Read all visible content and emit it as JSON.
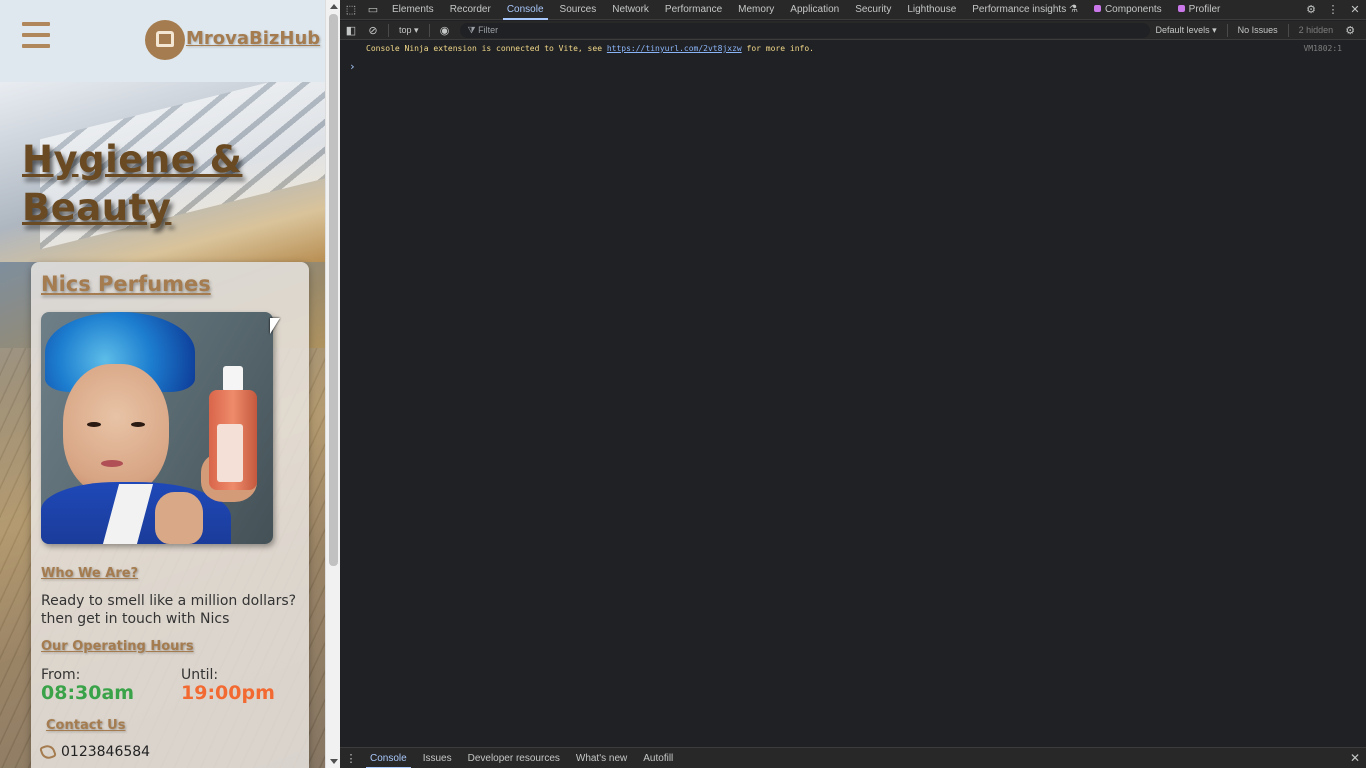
{
  "page": {
    "logo_text": "MrovaBizHub",
    "title": "Hygiene & Beauty",
    "card": {
      "name": "Nics Perfumes",
      "who_heading": "Who We Are?",
      "who_text": "Ready to smell like a million dollars? then get in touch with Nics",
      "hours_heading": "Our Operating Hours",
      "from_label": "From:",
      "from_time": "08:30am",
      "until_label": "Until:",
      "until_time": "19:00pm",
      "contact_heading": "Contact Us",
      "phone": "0123846584"
    },
    "colors": {
      "brand": "#a57c4f",
      "from_time": "#3aa34a",
      "until_time": "#f26a32"
    }
  },
  "devtools": {
    "tabs": [
      "Elements",
      "Recorder",
      "Console",
      "Sources",
      "Network",
      "Performance",
      "Memory",
      "Application",
      "Security",
      "Lighthouse",
      "Performance insights",
      "Components",
      "Profiler"
    ],
    "active_tab": "Console",
    "toolbar": {
      "context": "top",
      "filter_placeholder": "Filter",
      "levels": "Default levels",
      "issues": "No Issues",
      "hidden": "2 hidden"
    },
    "console": {
      "message_prefix": "Console Ninja extension is connected to Vite, see",
      "message_link": "https://tinyurl.com/2vt8jxzw",
      "message_suffix": "for more info.",
      "source": "VM1802:1",
      "prompt": "›"
    },
    "drawer_tabs": [
      "Console",
      "Issues",
      "Developer resources",
      "What's new",
      "Autofill"
    ],
    "drawer_active": "Console"
  }
}
